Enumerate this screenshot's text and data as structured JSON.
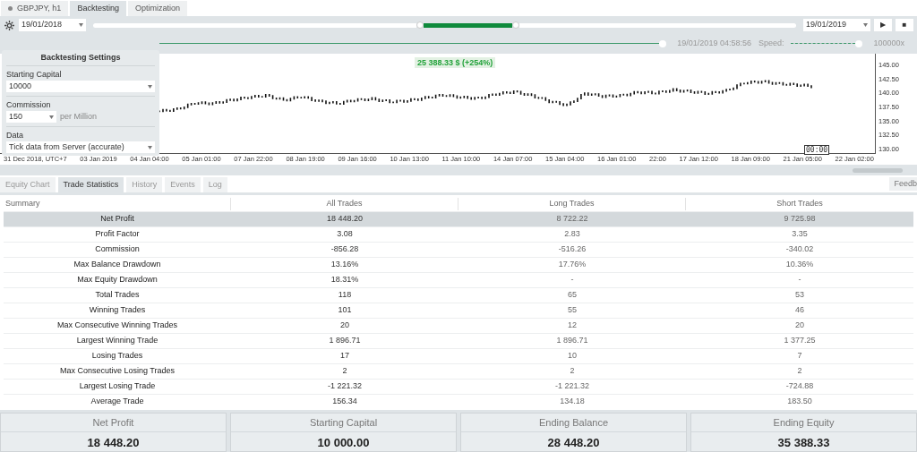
{
  "top_tabs": [
    {
      "label": "GBPJPY, h1",
      "selected": false,
      "kind": "symbol"
    },
    {
      "label": "Backtesting",
      "selected": true,
      "kind": "plain"
    },
    {
      "label": "Optimization",
      "selected": false,
      "kind": "plain"
    }
  ],
  "toolbar": {
    "start_date": "19/01/2018",
    "end_date": "19/01/2019",
    "range": {
      "start": {
        "level": 0.47
      },
      "end": {
        "level": 0.598
      }
    },
    "play": "▶",
    "stop": "■"
  },
  "playback": {
    "level": 1,
    "time": "19/01/2019 04:58:56",
    "speed_label": "Speed:",
    "speed": {
      "level": 1
    },
    "speed_value": "100000x"
  },
  "settings": {
    "title": "Backtesting Settings",
    "starting_capital": {
      "label": "Starting Capital",
      "value": "10000"
    },
    "commission": {
      "label": "Commission",
      "value": "150",
      "unit": "per Million"
    },
    "data": {
      "label": "Data",
      "value": "Tick data from Server (accurate)"
    }
  },
  "chart": {
    "equity_badge": "25 388.33 $ (+254%)",
    "price_ticks": [
      "145.00",
      "142.50",
      "140.00",
      "137.50",
      "135.00",
      "132.50",
      "130.00"
    ],
    "time_ticks": [
      "31 Dec 2018, UTC+7",
      "03 Jan 2019",
      "04 Jan 04:00",
      "05 Jan 01:00",
      "07 Jan 22:00",
      "08 Jan 19:00",
      "09 Jan 16:00",
      "10 Jan 13:00",
      "11 Jan 10:00",
      "14 Jan 07:00",
      "15 Jan 04:00",
      "16 Jan 01:00",
      "22:00",
      "17 Jan 12:00",
      "18 Jan 09:00",
      "21 Jan 05:00",
      "22 Jan 02:00"
    ],
    "cursor_label": "00:00"
  },
  "bottom_tabs": [
    {
      "label": "Equity Chart",
      "selected": false
    },
    {
      "label": "Trade Statistics",
      "selected": true
    },
    {
      "label": "History",
      "selected": false
    },
    {
      "label": "Events",
      "selected": false
    },
    {
      "label": "Log",
      "selected": false
    }
  ],
  "feedback": "Feedb",
  "table": {
    "columns": [
      "Summary",
      "All Trades",
      "Long Trades",
      "Short Trades"
    ],
    "rows": [
      {
        "cells": [
          "Net Profit",
          "18 448.20",
          "8 722.22",
          "9 725.98"
        ],
        "selected": true
      },
      {
        "cells": [
          "Profit Factor",
          "3.08",
          "2.83",
          "3.35"
        ],
        "selected": false
      },
      {
        "cells": [
          "Commission",
          "-856.28",
          "-516.26",
          "-340.02"
        ],
        "selected": false
      },
      {
        "cells": [
          "Max Balance Drawdown",
          "13.16%",
          "17.76%",
          "10.36%"
        ],
        "selected": false
      },
      {
        "cells": [
          "Max Equity Drawdown",
          "18.31%",
          "-",
          "-"
        ],
        "selected": false
      },
      {
        "cells": [
          "Total Trades",
          "118",
          "65",
          "53"
        ],
        "selected": false
      },
      {
        "cells": [
          "Winning Trades",
          "101",
          "55",
          "46"
        ],
        "selected": false
      },
      {
        "cells": [
          "Max Consecutive Winning Trades",
          "20",
          "12",
          "20"
        ],
        "selected": false
      },
      {
        "cells": [
          "Largest Winning Trade",
          "1 896.71",
          "1 896.71",
          "1 377.25"
        ],
        "selected": false
      },
      {
        "cells": [
          "Losing Trades",
          "17",
          "10",
          "7"
        ],
        "selected": false
      },
      {
        "cells": [
          "Max Consecutive Losing Trades",
          "2",
          "2",
          "2"
        ],
        "selected": false
      },
      {
        "cells": [
          "Largest Losing Trade",
          "-1 221.32",
          "-1 221.32",
          "-724.88"
        ],
        "selected": false
      },
      {
        "cells": [
          "Average Trade",
          "156.34",
          "134.18",
          "183.50"
        ],
        "selected": false
      }
    ]
  },
  "summary_cards": [
    {
      "label": "Net Profit",
      "value": "18 448.20"
    },
    {
      "label": "Starting Capital",
      "value": "10 000.00"
    },
    {
      "label": "Ending Balance",
      "value": "28 448.20"
    },
    {
      "label": "Ending Equity",
      "value": "35 388.33"
    }
  ]
}
